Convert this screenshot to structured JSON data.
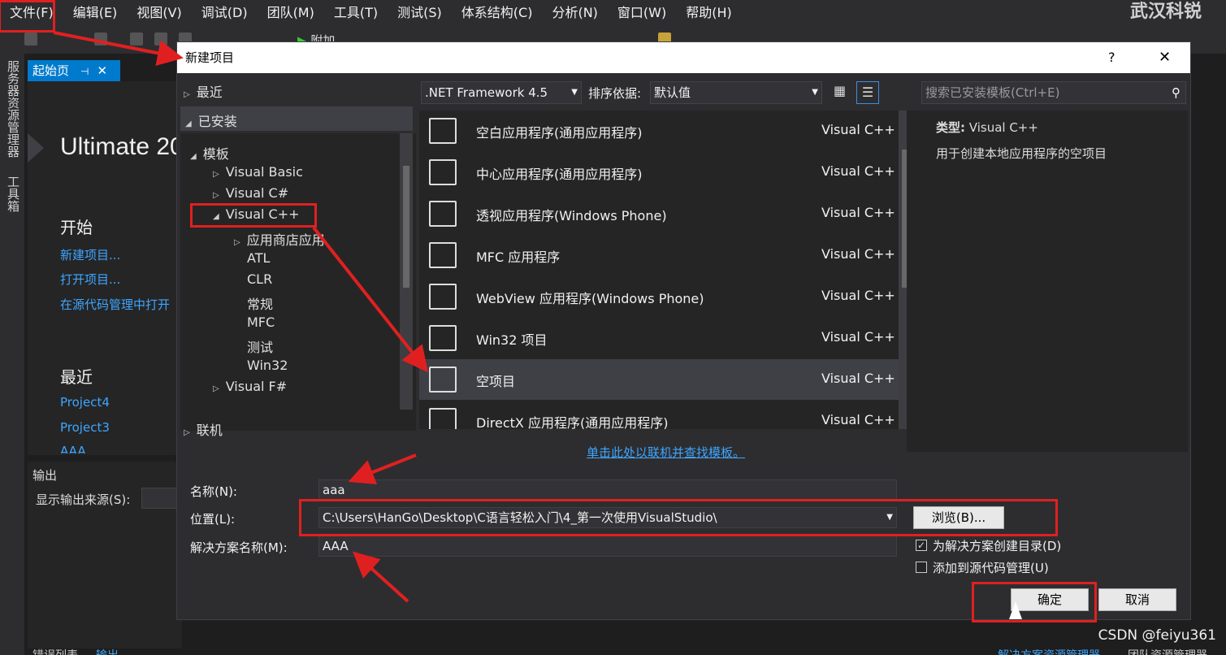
{
  "menubar": {
    "items": [
      "文件(F)",
      "编辑(E)",
      "视图(V)",
      "调试(D)",
      "团队(M)",
      "工具(T)",
      "测试(S)",
      "体系结构(C)",
      "分析(N)",
      "窗口(W)",
      "帮助(H)"
    ],
    "brand": "武汉科锐"
  },
  "toolbar": {
    "attach": "附加..."
  },
  "sidebar": {
    "server_explorer": "服务器资源管理器",
    "toolbox": "工具箱"
  },
  "doc_tab": {
    "label": "起始页"
  },
  "start_page": {
    "edition": "Ultimate 20",
    "start_heading": "开始",
    "links": [
      "新建项目...",
      "打开项目...",
      "在源代码管理中打开"
    ],
    "recent_heading": "最近",
    "recent": [
      "Project4",
      "Project3",
      "AAA"
    ]
  },
  "output_panel": {
    "title": "输出",
    "source_label": "显示输出来源(S):"
  },
  "bottom_tabs": [
    "错误列表",
    "输出"
  ],
  "right_bottom_tabs": [
    "解决方案资源管理器",
    "团队资源管理器"
  ],
  "dialog": {
    "title": "新建项目",
    "help": "?",
    "close": "✕",
    "tree": {
      "recent": "最近",
      "installed": "已安装",
      "templates": "模板",
      "vb": "Visual Basic",
      "cs": "Visual C#",
      "cpp": "Visual C++",
      "cpp_children": [
        "应用商店应用",
        "ATL",
        "CLR",
        "常规",
        "MFC",
        "测试",
        "Win32"
      ],
      "fs": "Visual F#",
      "online": "联机"
    },
    "framework": ".NET Framework 4.5",
    "sort_label": "排序依据:",
    "sort_value": "默认值",
    "search_placeholder": "搜索已安装模板(Ctrl+E)",
    "templates": [
      {
        "name": "空白应用程序(通用应用程序)",
        "lang": "Visual C++"
      },
      {
        "name": "中心应用程序(通用应用程序)",
        "lang": "Visual C++"
      },
      {
        "name": "透视应用程序(Windows Phone)",
        "lang": "Visual C++"
      },
      {
        "name": "MFC 应用程序",
        "lang": "Visual C++"
      },
      {
        "name": "WebView 应用程序(Windows Phone)",
        "lang": "Visual C++"
      },
      {
        "name": "Win32 项目",
        "lang": "Visual C++"
      },
      {
        "name": "空项目",
        "lang": "Visual C++",
        "selected": true
      },
      {
        "name": "DirectX 应用程序(通用应用程序)",
        "lang": "Visual C++"
      }
    ],
    "desc": {
      "type_label": "类型:",
      "type_value": "Visual C++",
      "text": "用于创建本地应用程序的空项目"
    },
    "online_link": "单击此处以联机并查找模板。",
    "name_label": "名称(N):",
    "name_value": "aaa",
    "location_label": "位置(L):",
    "location_value": "C:\\Users\\HanGo\\Desktop\\C语言轻松入门\\4_第一次使用VisualStudio\\",
    "browse": "浏览(B)...",
    "solution_label": "解决方案名称(M):",
    "solution_value": "AAA",
    "create_dir": "为解决方案创建目录(D)",
    "create_dir_checked": true,
    "add_scc": "添加到源代码管理(U)",
    "add_scc_checked": false,
    "ok": "确定",
    "cancel": "取消"
  },
  "watermark": "CSDN @feiyu361",
  "colors": {
    "accent": "#007acc",
    "annotation": "#e02020"
  }
}
